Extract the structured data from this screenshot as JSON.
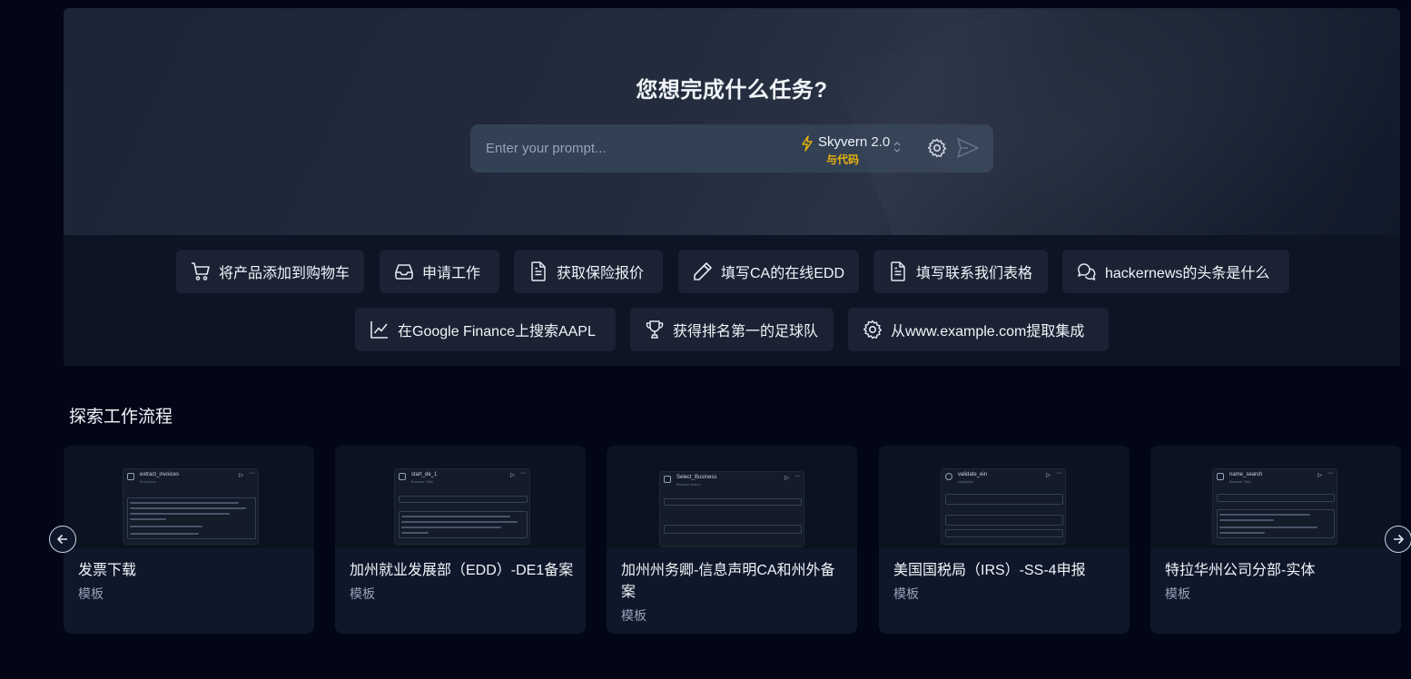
{
  "hero": {
    "title": "您想完成什么任务?",
    "prompt_placeholder": "Enter your prompt...",
    "model_name": "Skyvern 2.0",
    "model_sub": "与代码",
    "icons": [
      "bolt-icon",
      "updown-icon",
      "gear-icon",
      "send-icon"
    ],
    "colors": {
      "accent": "#eab308",
      "input_bg": "#334155"
    }
  },
  "suggestions": [
    {
      "label": "将产品添加到购物车",
      "icon": "shopping-cart-icon"
    },
    {
      "label": "申请工作",
      "icon": "inbox-icon"
    },
    {
      "label": "获取保险报价",
      "icon": "document-icon"
    },
    {
      "label": "填写CA的在线EDD",
      "icon": "pencil-icon"
    },
    {
      "label": "填写联系我们表格",
      "icon": "document-icon"
    },
    {
      "label": "hackernews的头条是什么",
      "icon": "chat-bubbles-icon"
    },
    {
      "label": "在Google Finance上搜索AAPL",
      "icon": "line-chart-icon"
    },
    {
      "label": "获得排名第一的足球队",
      "icon": "trophy-icon"
    },
    {
      "label": "从www.example.com提取集成",
      "icon": "gear-icon"
    }
  ],
  "explore": {
    "title": "探索工作流程",
    "cards": [
      {
        "title": "发票下载",
        "tag": "模板",
        "node_title": "extract_invoices",
        "node_sub": "Extraction"
      },
      {
        "title": "加州就业发展部（EDD）-DE1备案",
        "tag": "模板",
        "node_title": "start_de_1",
        "node_sub": "Browser Task"
      },
      {
        "title": "加州州务卿-信息声明CA和州外备案",
        "tag": "模板",
        "node_title": "Select_Business",
        "node_sub": "Browser Action"
      },
      {
        "title": "美国国税局（IRS）-SS-4申报",
        "tag": "模板",
        "node_title": "validate_ein",
        "node_sub": "Validation"
      },
      {
        "title": "特拉华州公司分部-实体",
        "tag": "模板",
        "node_title": "name_search",
        "node_sub": "Browser Task"
      }
    ],
    "nav_icons": [
      "arrow-left-icon",
      "arrow-right-icon"
    ]
  }
}
